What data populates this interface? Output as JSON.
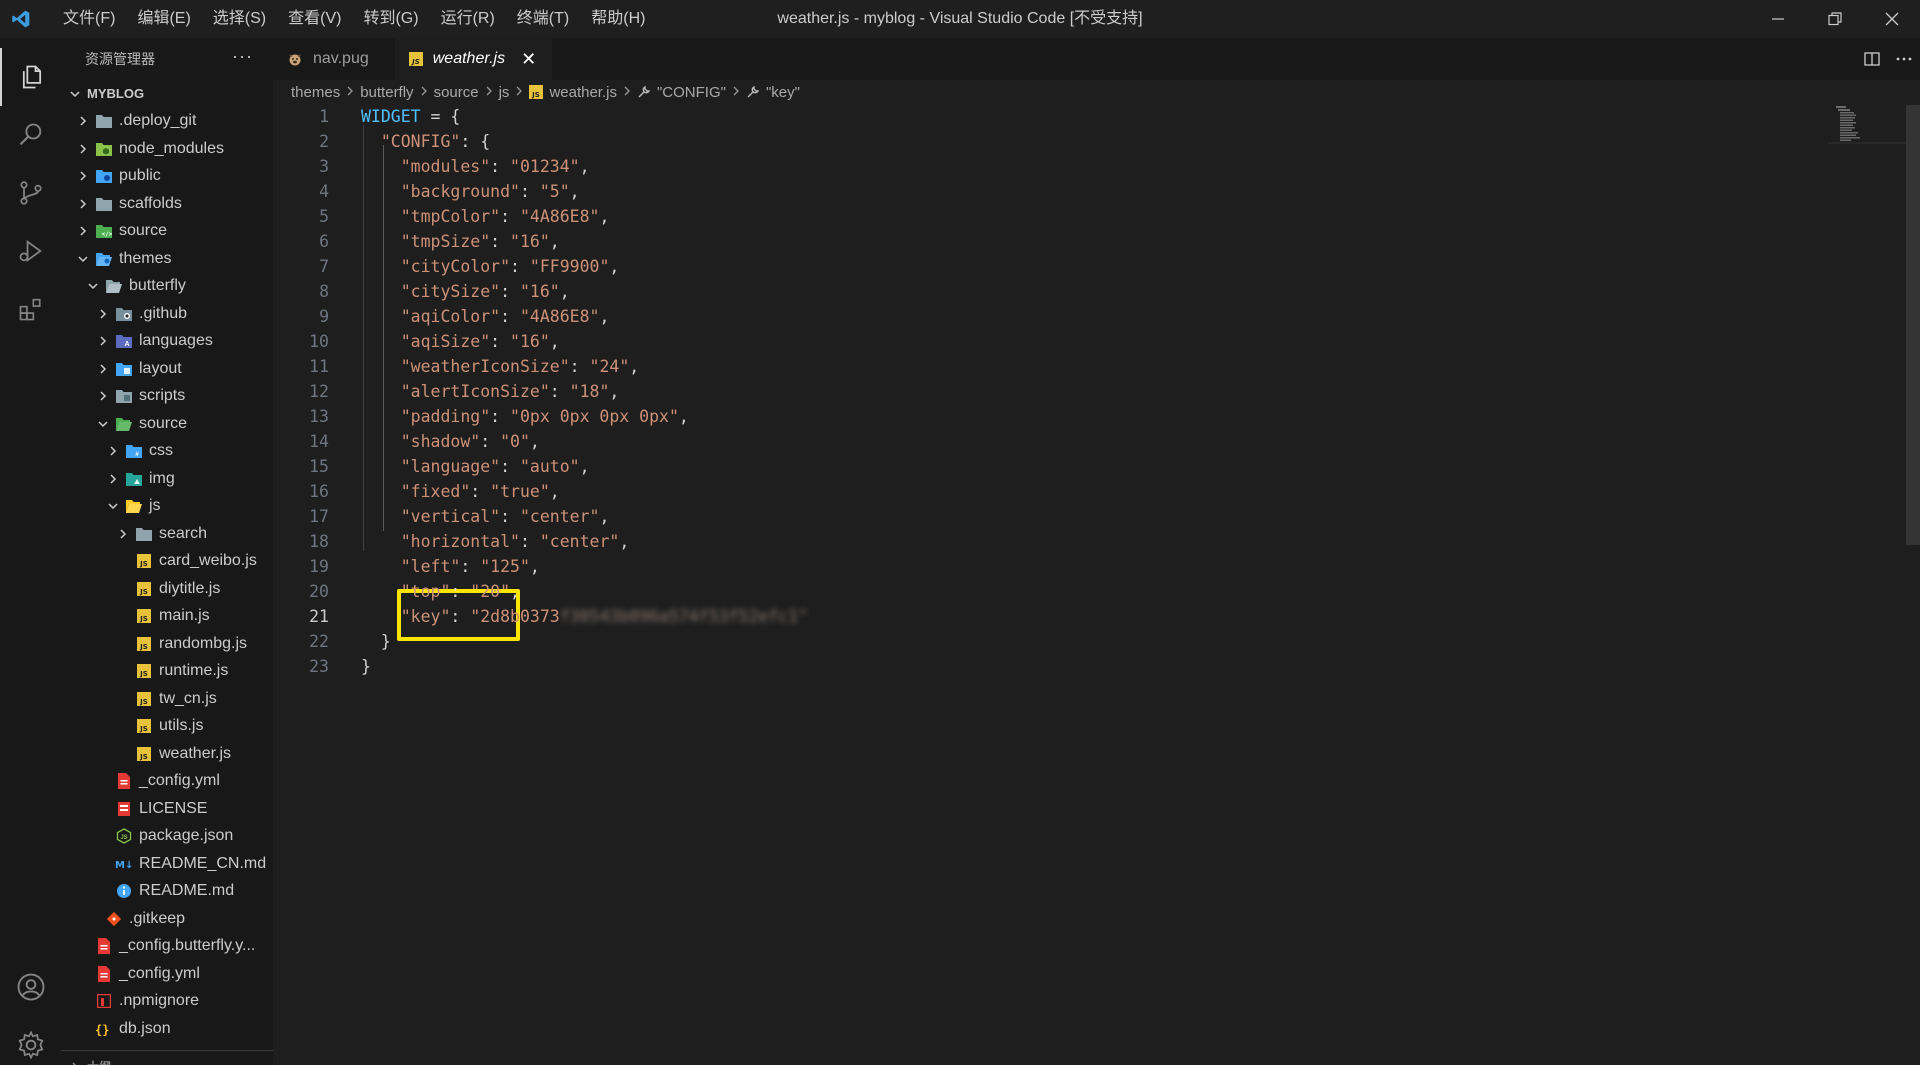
{
  "titlebar": {
    "menu": [
      "文件(F)",
      "编辑(E)",
      "选择(S)",
      "查看(V)",
      "转到(G)",
      "运行(R)",
      "终端(T)",
      "帮助(H)"
    ],
    "title": "weather.js - myblog - Visual Studio Code [不受支持]"
  },
  "sidebar": {
    "title": "资源管理器",
    "more": "···",
    "root": "MYBLOG",
    "items": [
      {
        "label": ".deploy_git",
        "depth": 1,
        "type": "folder",
        "open": false,
        "icon": "folder-git"
      },
      {
        "label": "node_modules",
        "depth": 1,
        "type": "folder",
        "open": false,
        "icon": "folder-node"
      },
      {
        "label": "public",
        "depth": 1,
        "type": "folder",
        "open": false,
        "icon": "folder-public"
      },
      {
        "label": "scaffolds",
        "depth": 1,
        "type": "folder",
        "open": false,
        "icon": "folder"
      },
      {
        "label": "source",
        "depth": 1,
        "type": "folder",
        "open": false,
        "icon": "folder-src"
      },
      {
        "label": "themes",
        "depth": 1,
        "type": "folder",
        "open": true,
        "icon": "folder-themes"
      },
      {
        "label": "butterfly",
        "depth": 2,
        "type": "folder",
        "open": true,
        "icon": "folder-open"
      },
      {
        "label": ".github",
        "depth": 3,
        "type": "folder",
        "open": false,
        "icon": "folder-github"
      },
      {
        "label": "languages",
        "depth": 3,
        "type": "folder",
        "open": false,
        "icon": "folder-lang"
      },
      {
        "label": "layout",
        "depth": 3,
        "type": "folder",
        "open": false,
        "icon": "folder-layout"
      },
      {
        "label": "scripts",
        "depth": 3,
        "type": "folder",
        "open": false,
        "icon": "folder-scripts"
      },
      {
        "label": "source",
        "depth": 3,
        "type": "folder",
        "open": true,
        "icon": "folder-src-open"
      },
      {
        "label": "css",
        "depth": 4,
        "type": "folder",
        "open": false,
        "icon": "folder-css"
      },
      {
        "label": "img",
        "depth": 4,
        "type": "folder",
        "open": false,
        "icon": "folder-img"
      },
      {
        "label": "js",
        "depth": 4,
        "type": "folder",
        "open": true,
        "icon": "folder-js-open"
      },
      {
        "label": "search",
        "depth": 5,
        "type": "folder",
        "open": false,
        "icon": "folder"
      },
      {
        "label": "card_weibo.js",
        "depth": 5,
        "type": "file",
        "icon": "js"
      },
      {
        "label": "diytitle.js",
        "depth": 5,
        "type": "file",
        "icon": "js"
      },
      {
        "label": "main.js",
        "depth": 5,
        "type": "file",
        "icon": "js"
      },
      {
        "label": "randombg.js",
        "depth": 5,
        "type": "file",
        "icon": "js"
      },
      {
        "label": "runtime.js",
        "depth": 5,
        "type": "file",
        "icon": "js"
      },
      {
        "label": "tw_cn.js",
        "depth": 5,
        "type": "file",
        "icon": "js"
      },
      {
        "label": "utils.js",
        "depth": 5,
        "type": "file",
        "icon": "js"
      },
      {
        "label": "weather.js",
        "depth": 5,
        "type": "file",
        "icon": "js",
        "selected": true
      },
      {
        "label": "_config.yml",
        "depth": 3,
        "type": "file",
        "icon": "yml"
      },
      {
        "label": "LICENSE",
        "depth": 3,
        "type": "file",
        "icon": "license"
      },
      {
        "label": "package.json",
        "depth": 3,
        "type": "file",
        "icon": "npm"
      },
      {
        "label": "README_CN.md",
        "depth": 3,
        "type": "file",
        "icon": "md"
      },
      {
        "label": "README.md",
        "depth": 3,
        "type": "file",
        "icon": "info"
      },
      {
        "label": ".gitkeep",
        "depth": 2,
        "type": "file",
        "icon": "git"
      },
      {
        "label": "_config.butterfly.y...",
        "depth": 1,
        "type": "file",
        "icon": "yml"
      },
      {
        "label": "_config.yml",
        "depth": 1,
        "type": "file",
        "icon": "yml"
      },
      {
        "label": ".npmignore",
        "depth": 1,
        "type": "file",
        "icon": "npmignore"
      },
      {
        "label": "db.json",
        "depth": 1,
        "type": "file",
        "icon": "json"
      }
    ],
    "outline_partial": "大纲"
  },
  "tabs": [
    {
      "label": "nav.pug",
      "icon": "pug",
      "active": false
    },
    {
      "label": "weather.js",
      "icon": "js",
      "active": true,
      "close": "✕"
    }
  ],
  "breadcrumb": [
    "themes",
    "butterfly",
    "source",
    "js",
    "weather.js",
    "\"CONFIG\"",
    "\"key\""
  ],
  "editor": {
    "current_line": 21,
    "lines": [
      "WIDGET = {",
      "  \"CONFIG\": {",
      "    \"modules\": \"01234\",",
      "    \"background\": \"5\",",
      "    \"tmpColor\": \"4A86E8\",",
      "    \"tmpSize\": \"16\",",
      "    \"cityColor\": \"FF9900\",",
      "    \"citySize\": \"16\",",
      "    \"aqiColor\": \"4A86E8\",",
      "    \"aqiSize\": \"16\",",
      "    \"weatherIconSize\": \"24\",",
      "    \"alertIconSize\": \"18\",",
      "    \"padding\": \"0px 0px 0px 0px\",",
      "    \"shadow\": \"0\",",
      "    \"language\": \"auto\",",
      "    \"fixed\": \"true\",",
      "    \"vertical\": \"center\",",
      "    \"horizontal\": \"center\",",
      "    \"left\": \"125\",",
      "    \"top\": \"20\",",
      "    \"key\": \"2d8b0373",
      "  }",
      "}"
    ],
    "key_blurred_suffix": "f30543b096a574f53f52efc1\""
  },
  "colors": {
    "accent_highlight": "#ffe600",
    "js_icon": "#e8c23a"
  }
}
